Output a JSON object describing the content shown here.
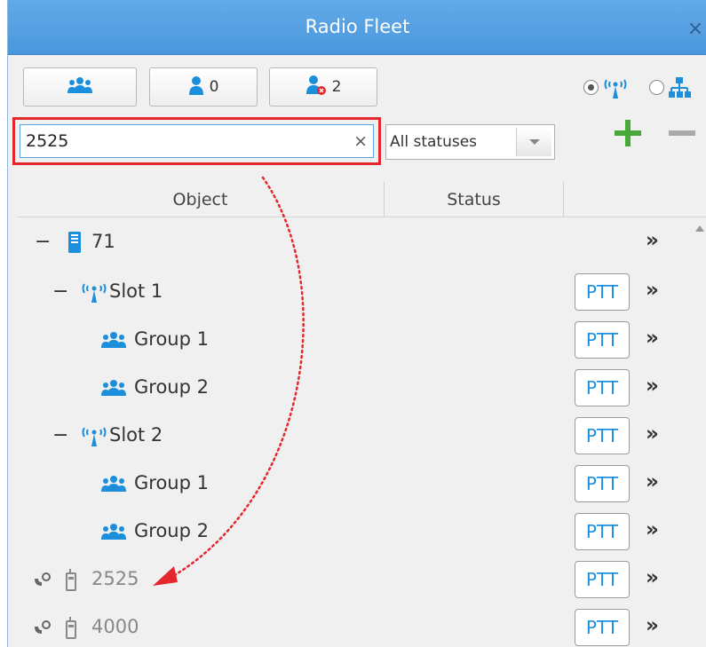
{
  "window": {
    "title": "Radio Fleet",
    "close_glyph": "×"
  },
  "toolbar": {
    "groups_button": {
      "icon": "groups-icon"
    },
    "subscribers_button": {
      "icon": "user-icon",
      "count": "0"
    },
    "offline_button": {
      "icon": "user-offline-icon",
      "count": "2"
    },
    "view_mode": {
      "radio_tree_selected": true,
      "radio_org_selected": false
    }
  },
  "search": {
    "value": "2525",
    "clear_glyph": "×"
  },
  "status_filter": {
    "selected": "All statuses"
  },
  "columns": {
    "object": "Object",
    "status": "Status"
  },
  "rows": [
    {
      "label": "71",
      "toggle": "−",
      "icon": "radio-server-icon",
      "ptt": "",
      "more": "»"
    },
    {
      "label": "Slot 1",
      "toggle": "−",
      "icon": "antenna-icon",
      "ptt": "PTT",
      "more": "»"
    },
    {
      "label": "Group 1",
      "toggle": "",
      "icon": "groups-icon",
      "ptt": "PTT",
      "more": "»"
    },
    {
      "label": "Group 2",
      "toggle": "",
      "icon": "groups-icon",
      "ptt": "PTT",
      "more": "»"
    },
    {
      "label": "Slot 2",
      "toggle": "−",
      "icon": "antenna-icon",
      "ptt": "PTT",
      "more": "»"
    },
    {
      "label": "Group 1",
      "toggle": "",
      "icon": "groups-icon",
      "ptt": "PTT",
      "more": "»"
    },
    {
      "label": "Group 2",
      "toggle": "",
      "icon": "groups-icon",
      "ptt": "PTT",
      "more": "»"
    },
    {
      "label": "2525",
      "toggle": "",
      "icon": "portable-radio-icon",
      "ptt": "PTT",
      "more": "»"
    },
    {
      "label": "4000",
      "toggle": "",
      "icon": "portable-radio-icon",
      "ptt": "PTT",
      "more": "»"
    }
  ],
  "colors": {
    "title_bar": "#4b97dd",
    "highlight_border": "#e3272d",
    "ptt_text": "#1e8fe0",
    "icon_blue": "#1b8fdc",
    "add_green": "#49a83a"
  }
}
